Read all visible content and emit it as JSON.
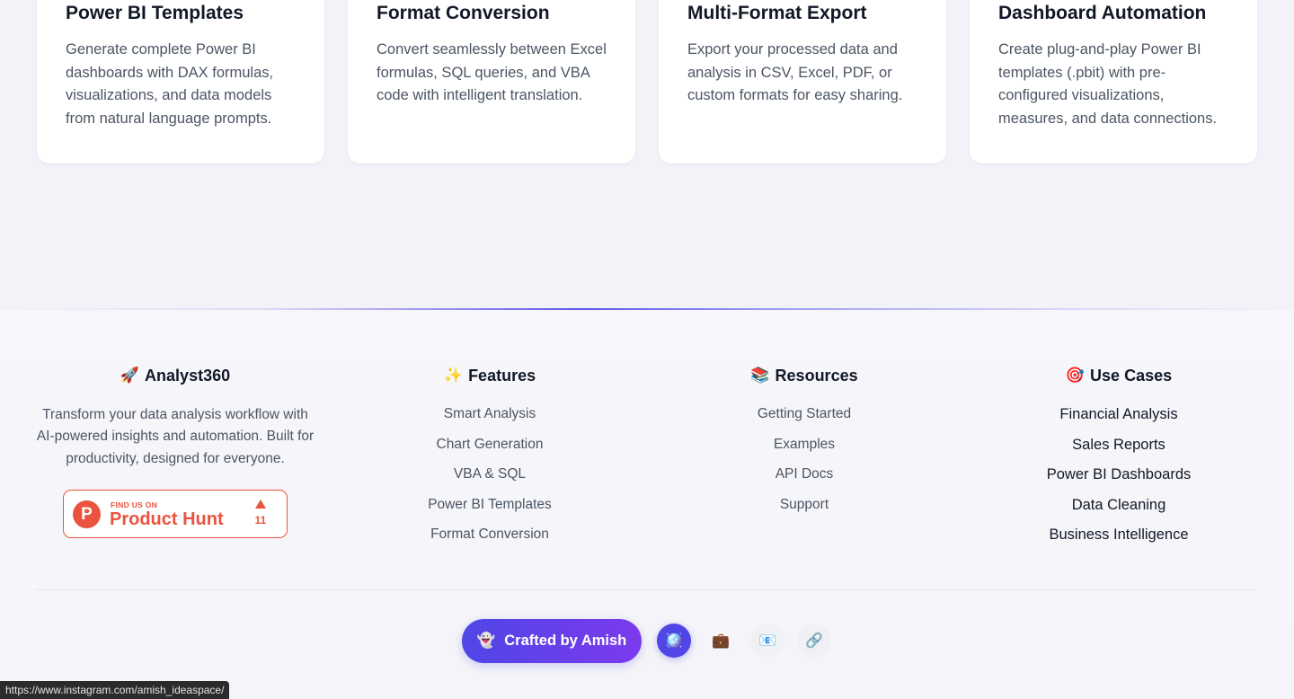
{
  "feature_cards": [
    {
      "title": "Power BI Templates",
      "description": "Generate complete Power BI dashboards with DAX formulas, visualizations, and data models from natural language prompts."
    },
    {
      "title": "Format Conversion",
      "description": "Convert seamlessly between Excel formulas, SQL queries, and VBA code with intelligent translation."
    },
    {
      "title": "Multi-Format Export",
      "description": "Export your processed data and analysis in CSV, Excel, PDF, or custom formats for easy sharing."
    },
    {
      "title": "Dashboard Automation",
      "description": "Create plug-and-play Power BI templates (.pbit) with pre-configured visualizations, measures, and data connections."
    }
  ],
  "footer": {
    "brand": {
      "icon": "🚀",
      "name": "Analyst360",
      "description": "Transform your data analysis workflow with AI-powered insights and automation. Built for productivity, designed for everyone."
    },
    "product_hunt": {
      "logo_letter": "P",
      "small_text": "FIND US ON",
      "big_text": "Product Hunt",
      "upvotes": "11",
      "brand_color": "#ea533f"
    },
    "features": {
      "icon": "✨",
      "title": "Features",
      "links": [
        "Smart Analysis",
        "Chart Generation",
        "VBA & SQL",
        "Power BI Templates",
        "Format Conversion"
      ]
    },
    "resources": {
      "icon": "📚",
      "title": "Resources",
      "links": [
        "Getting Started",
        "Examples",
        "API Docs",
        "Support"
      ]
    },
    "use_cases": {
      "icon": "🎯",
      "title": "Use Cases",
      "links": [
        "Financial Analysis",
        "Sales Reports",
        "Power BI Dashboards",
        "Data Cleaning",
        "Business Intelligence"
      ]
    },
    "crafted": {
      "icon": "👻",
      "label": "Crafted by Amish"
    },
    "socials": [
      {
        "name": "instagram",
        "icon": "🪩"
      },
      {
        "name": "portfolio",
        "icon": "💼"
      },
      {
        "name": "email",
        "icon": "📧"
      },
      {
        "name": "link",
        "icon": "🔗"
      }
    ]
  },
  "status_bar": {
    "url": "https://www.instagram.com/amish_ideaspace/"
  },
  "colors": {
    "accent": "#4f46e5",
    "accent_end": "#7c3aed",
    "background": "#f2f2f8"
  }
}
